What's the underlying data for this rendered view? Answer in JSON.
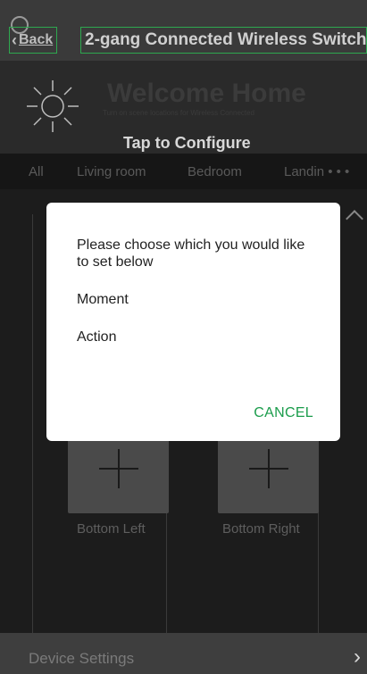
{
  "header": {
    "back_label": "Back",
    "title": "2-gang Connected Wireless Switch"
  },
  "hero": {
    "welcome": "Welcome Home",
    "subtitle": "Turn on scene locations for Wireless Connected",
    "tap_configure": "Tap to Configure"
  },
  "tabs": [
    "All",
    "Living room",
    "Bedroom",
    "Landin • • •"
  ],
  "tiles": {
    "bottom_left": "Bottom Left",
    "bottom_right": "Bottom Right"
  },
  "footer": {
    "label": "Device Settings"
  },
  "dialog": {
    "prompt": "Please choose which you would like to set below",
    "options": [
      "Moment",
      "Action"
    ],
    "cancel_label": "CANCEL"
  },
  "colors": {
    "accent": "#1a9c4b",
    "background": "#1e1e1e"
  }
}
